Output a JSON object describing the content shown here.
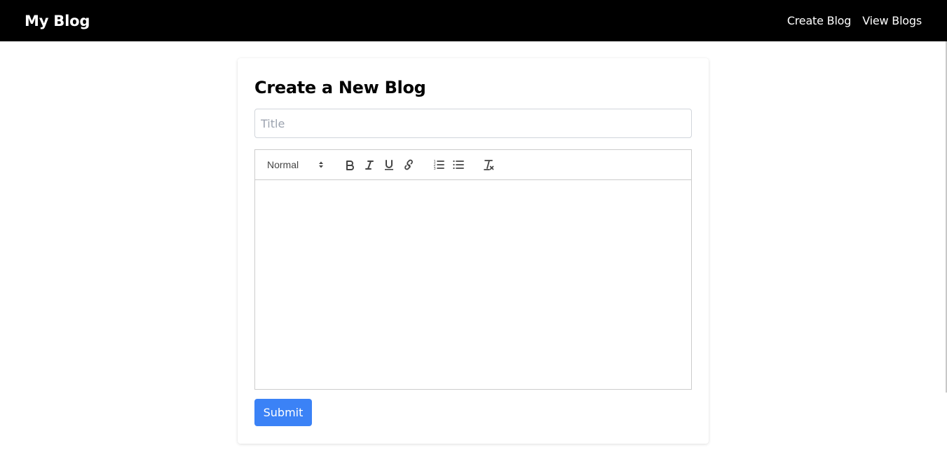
{
  "navbar": {
    "brand": "My Blog",
    "links": [
      "Create Blog",
      "View Blogs"
    ]
  },
  "form": {
    "heading": "Create a New Blog",
    "title_placeholder": "Title",
    "title_value": "",
    "editor": {
      "heading_picker_value": "Normal",
      "toolbar_icons": [
        "bold-icon",
        "italic-icon",
        "underline-icon",
        "link-icon",
        "ordered-list-icon",
        "bullet-list-icon",
        "clear-format-icon"
      ],
      "content": ""
    },
    "submit_label": "Submit"
  },
  "colors": {
    "navbar_bg": "#000000",
    "accent": "#3b82f6"
  }
}
